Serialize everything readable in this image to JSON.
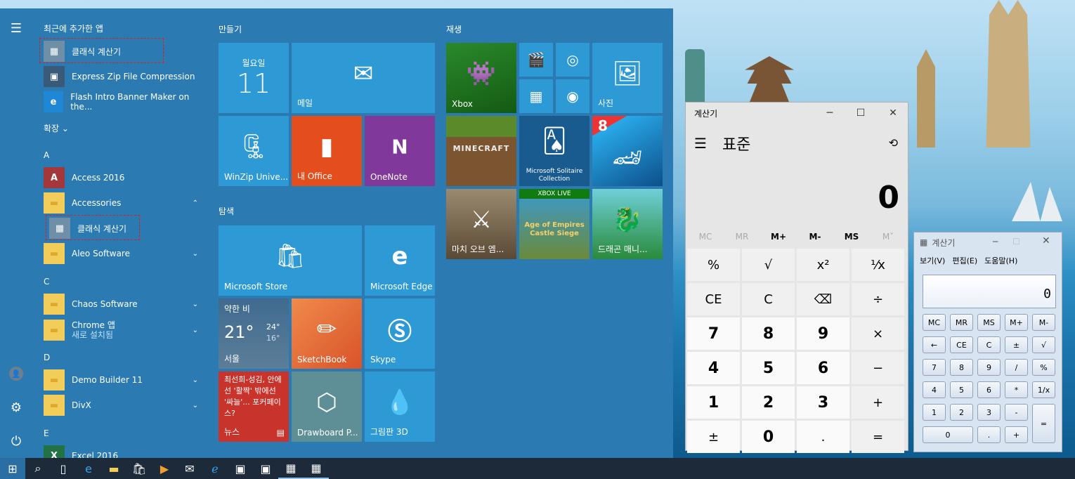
{
  "rail": {
    "icons": [
      "hamburger-icon",
      "user-icon",
      "settings-icon",
      "power-icon"
    ]
  },
  "applist": {
    "recent_header": "최근에 추가한 앱",
    "recent": [
      "클래식 계산기",
      "Express Zip File Compression",
      "Flash Intro Banner Maker on the..."
    ],
    "expand_label": "확장",
    "letters": {
      "a": "A",
      "c": "C",
      "d": "D",
      "e": "E"
    },
    "apps": {
      "access": "Access 2016",
      "accessories": "Accessories",
      "classic_calc": "클래식 계산기",
      "aleo": "Aleo Software",
      "chaos": "Chaos Software",
      "chrome": "Chrome 앱",
      "chrome_sub": "새로 설치됨",
      "demo": "Demo Builder 11",
      "divx": "DivX",
      "excel": "Excel 2016"
    }
  },
  "tiles": {
    "group_make": "만들기",
    "group_play": "재생",
    "group_explore": "탐색",
    "calendar_day": "월요일",
    "calendar_date": "11",
    "mail": "메일",
    "winzip": "WinZip Unive...",
    "office": "내 Office",
    "onenote": "OneNote",
    "xbox": "Xbox",
    "photos": "사진",
    "minecraft": "MINECRAFT",
    "solitaire": "Microsoft Solitaire Collection",
    "asphalt_num": "8",
    "march": "마치 오브 엠...",
    "xboxlive": "XBOX LIVE",
    "aoe": "Age of Empires Castle Siege",
    "dragon": "드래곤 매니...",
    "store": "Microsoft Store",
    "edge": "Microsoft Edge",
    "weather_cond": "약한 비",
    "weather_temp": "21°",
    "weather_hi": "24°",
    "weather_lo": "16°",
    "weather_city": "서울",
    "sketchbook": "SketchBook",
    "skype": "Skype",
    "news_text": "최선희-성김, 안에선 '활짝' 밖에선 '싸늘'... 포커페이스?",
    "news": "뉴스",
    "drawboard": "Drawboard P...",
    "paint3d": "그림판 3D"
  },
  "calc": {
    "title": "계산기",
    "mode": "표준",
    "display": "0",
    "memory": [
      "MC",
      "MR",
      "M+",
      "M-",
      "MS",
      "M˅"
    ],
    "keys": [
      [
        "%",
        "√",
        "x²",
        "¹⁄x"
      ],
      [
        "CE",
        "C",
        "⌫",
        "÷"
      ],
      [
        "7",
        "8",
        "9",
        "×"
      ],
      [
        "4",
        "5",
        "6",
        "−"
      ],
      [
        "1",
        "2",
        "3",
        "+"
      ],
      [
        "±",
        "0",
        ".",
        "="
      ]
    ]
  },
  "classic_calc": {
    "title": "계산기",
    "menu": [
      "보기(V)",
      "편집(E)",
      "도움말(H)"
    ],
    "display": "0",
    "rows": [
      [
        "MC",
        "MR",
        "MS",
        "M+",
        "M-"
      ],
      [
        "←",
        "CE",
        "C",
        "±",
        "√"
      ],
      [
        "7",
        "8",
        "9",
        "/",
        "%"
      ],
      [
        "4",
        "5",
        "6",
        "*",
        "1/x"
      ],
      [
        "1",
        "2",
        "3",
        "-",
        ""
      ]
    ],
    "zero": "0",
    "dot": ".",
    "plus": "+",
    "equals": "="
  },
  "colors": {
    "start_bg": "#2b7bb2",
    "tile_blue": "#2d9ad6",
    "office_red": "#e34e1c",
    "onenote_purple": "#80399b",
    "news_red": "#c8332b",
    "taskbar": "#1d2a3a"
  }
}
